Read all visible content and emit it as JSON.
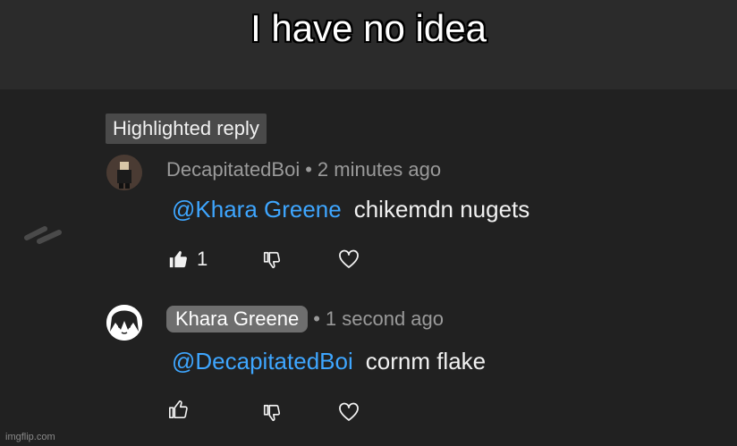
{
  "caption": "I have no idea",
  "highlight_label": "Highlighted reply",
  "comments": [
    {
      "author": "DecapitatedBoi",
      "time": "2 minutes ago",
      "mention": "@Khara Greene",
      "text": "chikemdn nugets",
      "likes": "1",
      "liked": true
    },
    {
      "author": "Khara Greene",
      "time": "1 second ago",
      "mention": "@DecapitatedBoi",
      "text": "cornm flake",
      "likes": "",
      "liked": false
    }
  ],
  "watermark": "imgflip.com",
  "colors": {
    "mention": "#3ea6ff",
    "background": "#212121",
    "caption_bar": "#2b2b2b"
  }
}
